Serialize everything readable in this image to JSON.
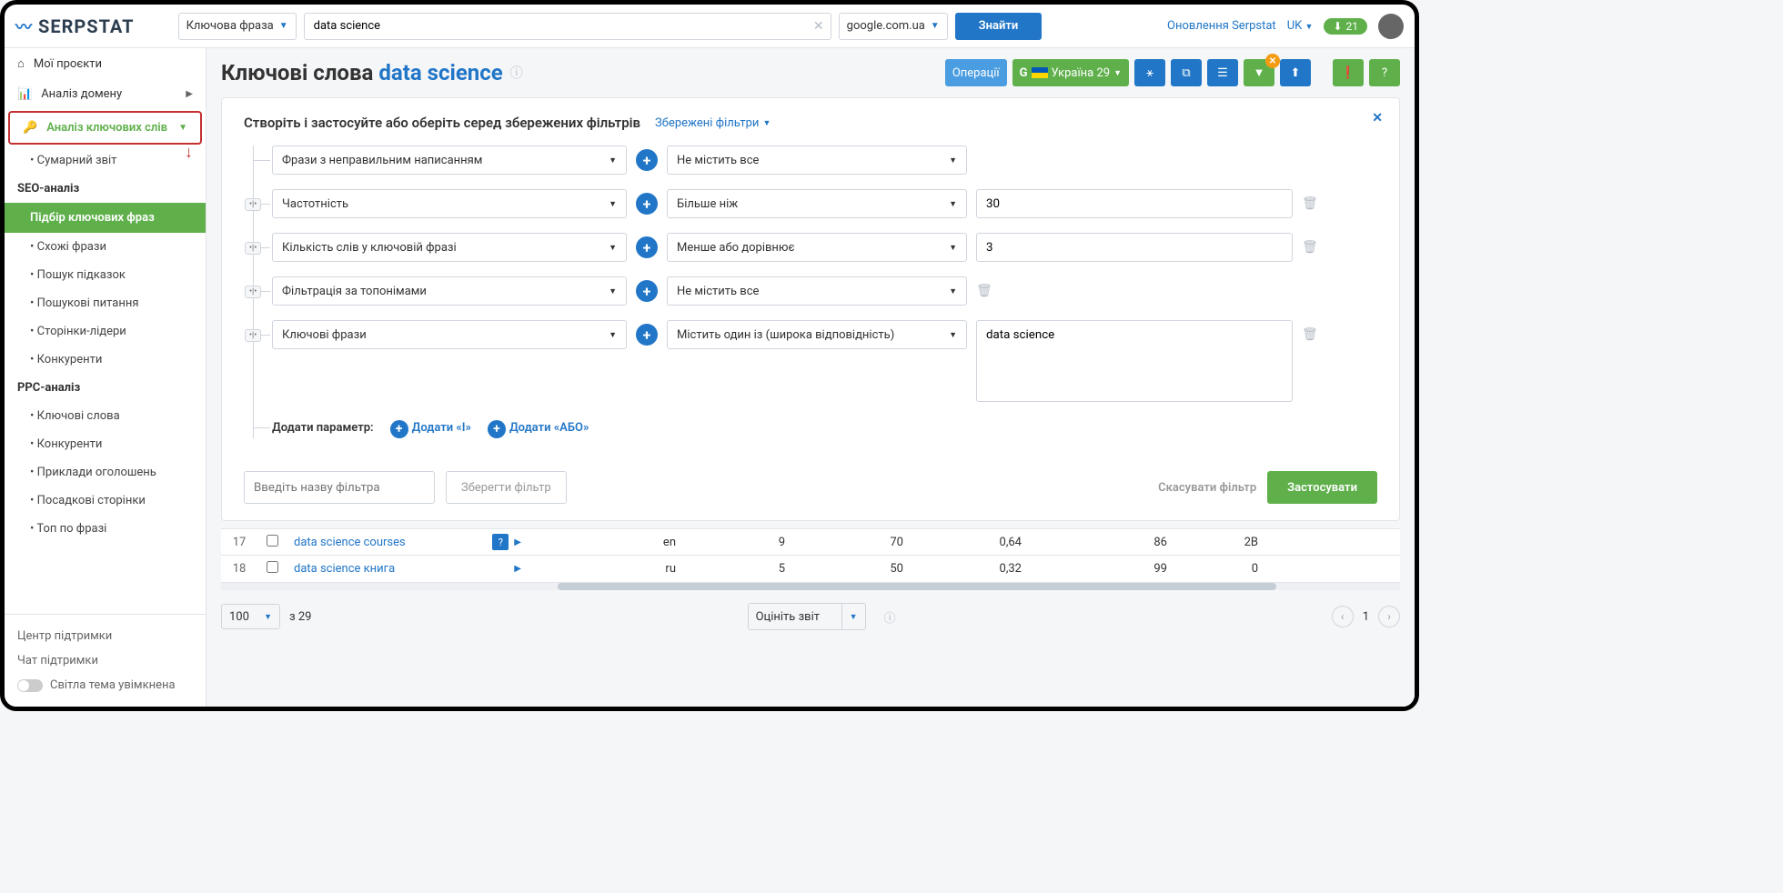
{
  "topbar": {
    "logo_text": "SERPSTAT",
    "mode_label": "Ключова фраза",
    "search_value": "data science",
    "region": "google.com.ua",
    "find_btn": "Знайти",
    "update_link": "Оновлення Serpstat",
    "lang": "UK",
    "downloads": "21"
  },
  "sidebar": {
    "my_projects": "Мої проєкти",
    "domain_analysis": "Аналіз домену",
    "keyword_analysis": "Аналіз ключових слів",
    "summary": "Сумарний звіт",
    "seo_header": "SEO-аналіз",
    "keyword_selection": "Підбір ключових фраз",
    "related": "Схожі фрази",
    "suggestions": "Пошук підказок",
    "questions": "Пошукові питання",
    "top_pages": "Сторінки-лідери",
    "competitors": "Конкуренти",
    "ppc_header": "PPC-аналіз",
    "ppc_keywords": "Ключові слова",
    "ppc_competitors": "Конкуренти",
    "ppc_ads": "Приклади оголошень",
    "ppc_landing": "Посадкові сторінки",
    "ppc_top": "Топ по фразі",
    "support_center": "Центр підтримки",
    "support_chat": "Чат підтримки",
    "theme_toggle": "Світла тема увімкнена"
  },
  "page": {
    "title_prefix": "Ключові слова",
    "title_keyword": "data science",
    "operations": "Операції",
    "country_label": "Україна 29"
  },
  "filter": {
    "title": "Створіть і застосуйте або оберіть серед збережених фільтрів",
    "saved": "Збережені фільтри",
    "or_badge": "•|•",
    "rows": [
      {
        "param": "Фрази з неправильним написанням",
        "op": "Не містить все",
        "val": "",
        "has_input": false,
        "has_or": false,
        "trash": false
      },
      {
        "param": "Частотність",
        "op": "Більше ніж",
        "val": "30",
        "has_input": true,
        "has_or": true,
        "trash": true
      },
      {
        "param": "Кількість слів у ключовій фразі",
        "op": "Менше або дорівнює",
        "val": "3",
        "has_input": true,
        "has_or": true,
        "trash": true
      },
      {
        "param": "Фільтрація за топонімами",
        "op": "Не містить все",
        "val": "",
        "has_input": false,
        "has_or": true,
        "trash": true
      },
      {
        "param": "Ключові фрази",
        "op": "Містить один із (широка відповідність)",
        "val": "data science",
        "has_input": true,
        "has_or": true,
        "textarea": true,
        "trash": true
      }
    ],
    "add_label": "Додати параметр:",
    "add_and": "Додати «І»",
    "add_or": "Додати «АБО»",
    "name_placeholder": "Введіть назву фільтра",
    "save_btn": "Зберегти фільтр",
    "cancel_btn": "Скасувати фільтр",
    "apply_btn": "Застосувати"
  },
  "table": {
    "rows": [
      {
        "n": "17",
        "kw": "data science courses",
        "badge": true,
        "lang": "en",
        "c1": "9",
        "c2": "70",
        "c3": "0,64",
        "c4": "86",
        "c5": "2B"
      },
      {
        "n": "18",
        "kw": "data science книга",
        "badge": false,
        "lang": "ru",
        "c1": "5",
        "c2": "50",
        "c3": "0,32",
        "c4": "99",
        "c5": "0"
      }
    ]
  },
  "pagination": {
    "per_page": "100",
    "total_label": "з 29",
    "rate_label": "Оцініть звіт",
    "page": "1"
  }
}
